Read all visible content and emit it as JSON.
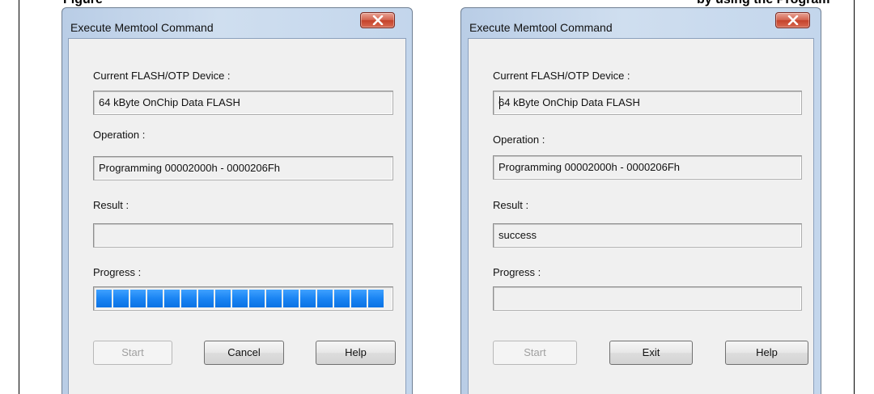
{
  "headings": {
    "left": "Figure",
    "right": "by using the Program"
  },
  "dialog_running": {
    "title": "Execute Memtool Command",
    "device_label": "Current FLASH/OTP Device :",
    "device_value": "64 kByte OnChip Data FLASH",
    "operation_label": "Operation :",
    "operation_value": "Programming 00002000h - 0000206Fh",
    "result_label": "Result :",
    "result_value": "",
    "progress_label": "Progress :",
    "progress_fraction": 1.0,
    "start_label": "Start",
    "cancel_label": "Cancel",
    "help_label": "Help"
  },
  "dialog_done": {
    "title": "Execute Memtool Command",
    "device_label": "Current FLASH/OTP Device :",
    "device_value": "64 kByte OnChip Data FLASH",
    "operation_label": "Operation :",
    "operation_value": "Programming 00002000h - 0000206Fh",
    "result_label": "Result :",
    "result_value": "success",
    "progress_label": "Progress :",
    "progress_fraction": 0,
    "start_label": "Start",
    "exit_label": "Exit",
    "help_label": "Help"
  },
  "colors": {
    "progress_fill": "#1a84f3",
    "close_button": "#c4422a"
  },
  "icons": {
    "close": "close-icon"
  }
}
